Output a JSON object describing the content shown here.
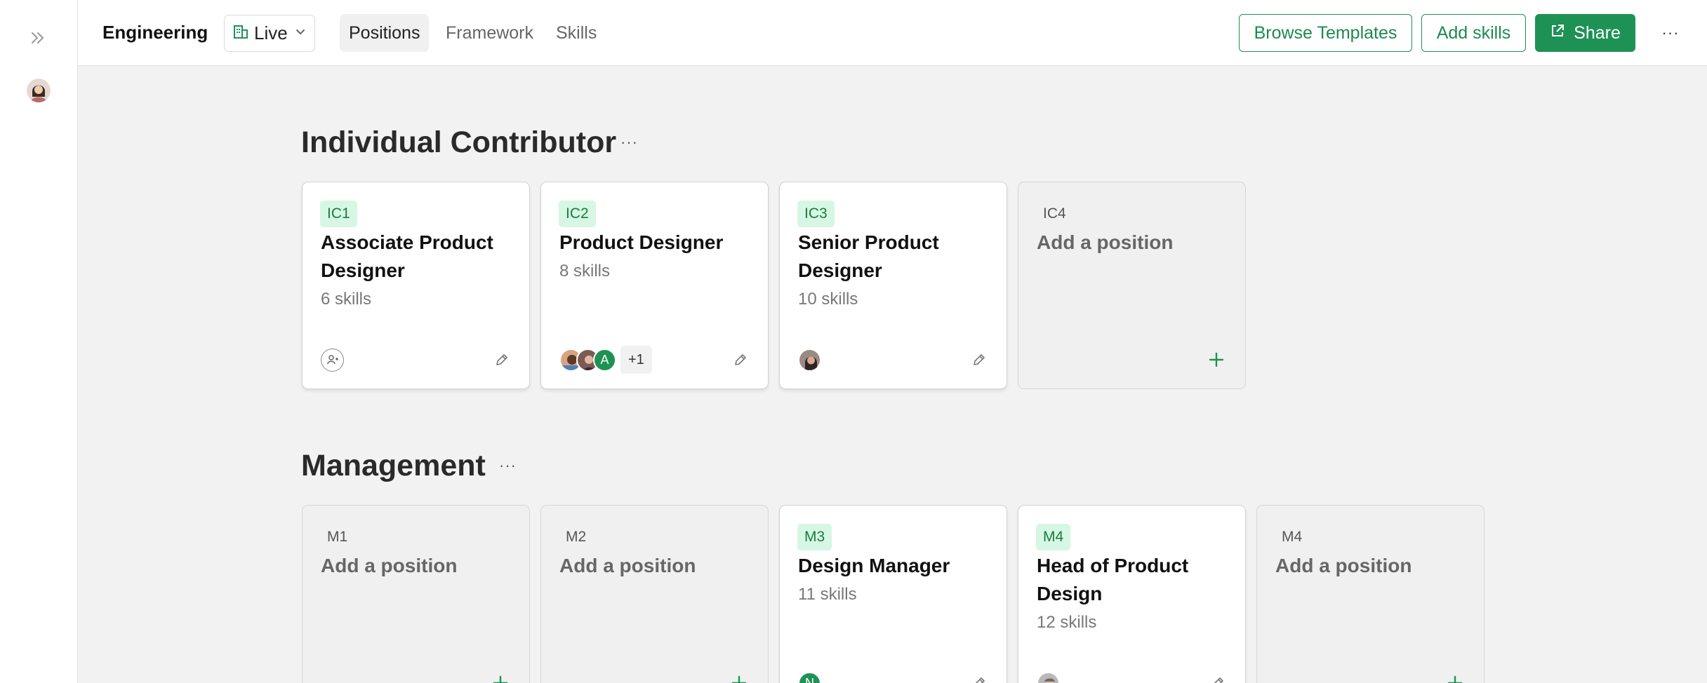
{
  "header": {
    "workspace": "Engineering",
    "status": "Live",
    "tabs": [
      "Positions",
      "Framework",
      "Skills"
    ],
    "active_tab": "Positions",
    "browse_templates": "Browse Templates",
    "add_skills": "Add skills",
    "share": "Share"
  },
  "colors": {
    "accent": "#1e9254",
    "level_badge_bg": "#d6f7e3"
  },
  "sections": [
    {
      "title": "Individual Contributor",
      "cards": [
        {
          "level": "IC1",
          "title": "Associate Product Designer",
          "skills": "6 skills"
        },
        {
          "level": "IC2",
          "title": "Product Designer",
          "skills": "8 skills",
          "avatar_letter": "A",
          "more": "+1"
        },
        {
          "level": "IC3",
          "title": "Senior Product Designer",
          "skills": "10 skills"
        },
        {
          "level": "IC4",
          "title": "Add a position"
        }
      ]
    },
    {
      "title": "Management",
      "cards": [
        {
          "level": "M1",
          "title": "Add a position"
        },
        {
          "level": "M2",
          "title": "Add a position"
        },
        {
          "level": "M3",
          "title": "Design Manager",
          "skills": "11 skills",
          "avatar_letter": "N"
        },
        {
          "level": "M4",
          "title": "Head of Product Design",
          "skills": "12 skills"
        },
        {
          "level": "M4",
          "title": "Add a position"
        }
      ]
    }
  ]
}
